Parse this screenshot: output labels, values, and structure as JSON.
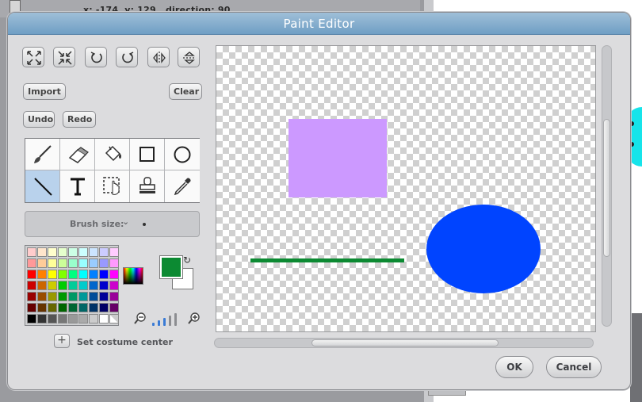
{
  "background_app": {
    "readout": "x: -174  y: 129   direction: 90"
  },
  "dialog": {
    "title": "Paint Editor",
    "toolbar_icons": [
      "grow-icon",
      "shrink-icon",
      "rotate-left-icon",
      "rotate-right-icon",
      "flip-horizontal-icon",
      "flip-vertical-icon"
    ],
    "import_label": "Import",
    "clear_label": "Clear",
    "undo_label": "Undo",
    "redo_label": "Redo",
    "tools": [
      "paintbrush",
      "eraser",
      "fill",
      "rectangle",
      "ellipse",
      "line",
      "text",
      "select",
      "stamp",
      "eyedropper"
    ],
    "selected_tool": "line",
    "brush_size_label": "Brush size:",
    "foreground_color": "#0c8a32",
    "background_color": "#ffffff",
    "set_center_label": "Set costume center",
    "ok_label": "OK",
    "cancel_label": "Cancel",
    "palette_rows": [
      [
        "#ffcccc",
        "#ffe5cc",
        "#ffffcc",
        "#e5ffcc",
        "#ccffe5",
        "#ccffff",
        "#cce5ff",
        "#ccccff",
        "#ffccff"
      ],
      [
        "#ff9999",
        "#ffcc99",
        "#ffff99",
        "#ccff99",
        "#99ffcc",
        "#99ffff",
        "#99ccff",
        "#9999ff",
        "#ff99ff"
      ],
      [
        "#ff0000",
        "#ff8000",
        "#ffff00",
        "#80ff00",
        "#00ff80",
        "#00ffff",
        "#0080ff",
        "#0000ff",
        "#ff00ff"
      ],
      [
        "#cc0000",
        "#cc6600",
        "#cccc00",
        "#00cc00",
        "#00cc99",
        "#00cccc",
        "#0066cc",
        "#0000cc",
        "#cc00cc"
      ],
      [
        "#990000",
        "#994c00",
        "#999900",
        "#009900",
        "#009966",
        "#009999",
        "#004c99",
        "#000099",
        "#990099"
      ],
      [
        "#660000",
        "#663300",
        "#666600",
        "#006600",
        "#006633",
        "#006666",
        "#003366",
        "#000066",
        "#660066"
      ],
      [
        "#000000",
        "#333333",
        "#555555",
        "#777777",
        "#999999",
        "#aaaaaa",
        "#cccccc",
        "#ffffff",
        "transparent"
      ]
    ],
    "canvas_shapes": {
      "rectangle_color": "#cc99ff",
      "line_color": "#0c8a32",
      "ellipse_color": "#0044ff"
    }
  }
}
